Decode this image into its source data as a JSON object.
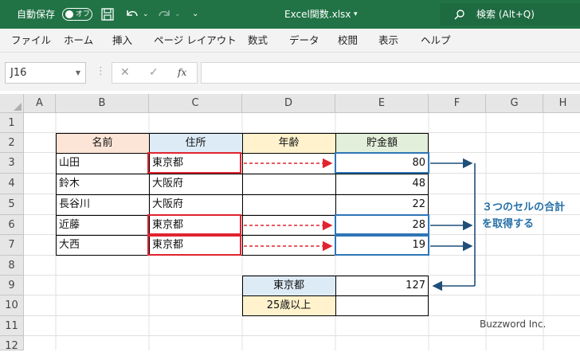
{
  "titlebar": {
    "autosave_label": "自動保存",
    "autosave_state": "オフ",
    "filename": "Excel関数.xlsx",
    "search_label": "検索 (Alt+Q)"
  },
  "ribbon": {
    "tabs": [
      "ファイル",
      "ホーム",
      "挿入",
      "ページ レイアウト",
      "数式",
      "データ",
      "校閲",
      "表示",
      "ヘルプ"
    ]
  },
  "formula_bar": {
    "name_box": "J16",
    "fx": "fx",
    "formula": ""
  },
  "sheet": {
    "columns": [
      "A",
      "B",
      "C",
      "D",
      "E",
      "F",
      "G",
      "H"
    ],
    "rows": [
      "1",
      "2",
      "3",
      "4",
      "5",
      "6",
      "7",
      "8",
      "9",
      "10",
      "11",
      "12"
    ],
    "table": {
      "headers": [
        "名前",
        "住所",
        "年齢",
        "貯金額"
      ],
      "rows": [
        [
          "山田",
          "東京都",
          "",
          "80"
        ],
        [
          "鈴木",
          "大阪府",
          "",
          "48"
        ],
        [
          "長谷川",
          "大阪府",
          "",
          "22"
        ],
        [
          "近藤",
          "東京都",
          "",
          "28"
        ],
        [
          "大西",
          "東京都",
          "",
          "19"
        ]
      ]
    },
    "criteria": [
      {
        "label": "東京都",
        "value": "127"
      },
      {
        "label": "25歳以上",
        "value": ""
      }
    ]
  },
  "annotation": {
    "line1": "３つのセルの合計",
    "line2": "を取得する"
  },
  "footnote": "Buzzword Inc.",
  "colors": {
    "title_bar": "#217346",
    "header_name": "#fce4d6",
    "header_address": "#ddebf7",
    "header_age": "#fff2cc",
    "header_savings": "#e2efda",
    "red_highlight": "#e0242f",
    "blue_highlight": "#2e75b6",
    "annotation": "#2670a8"
  }
}
